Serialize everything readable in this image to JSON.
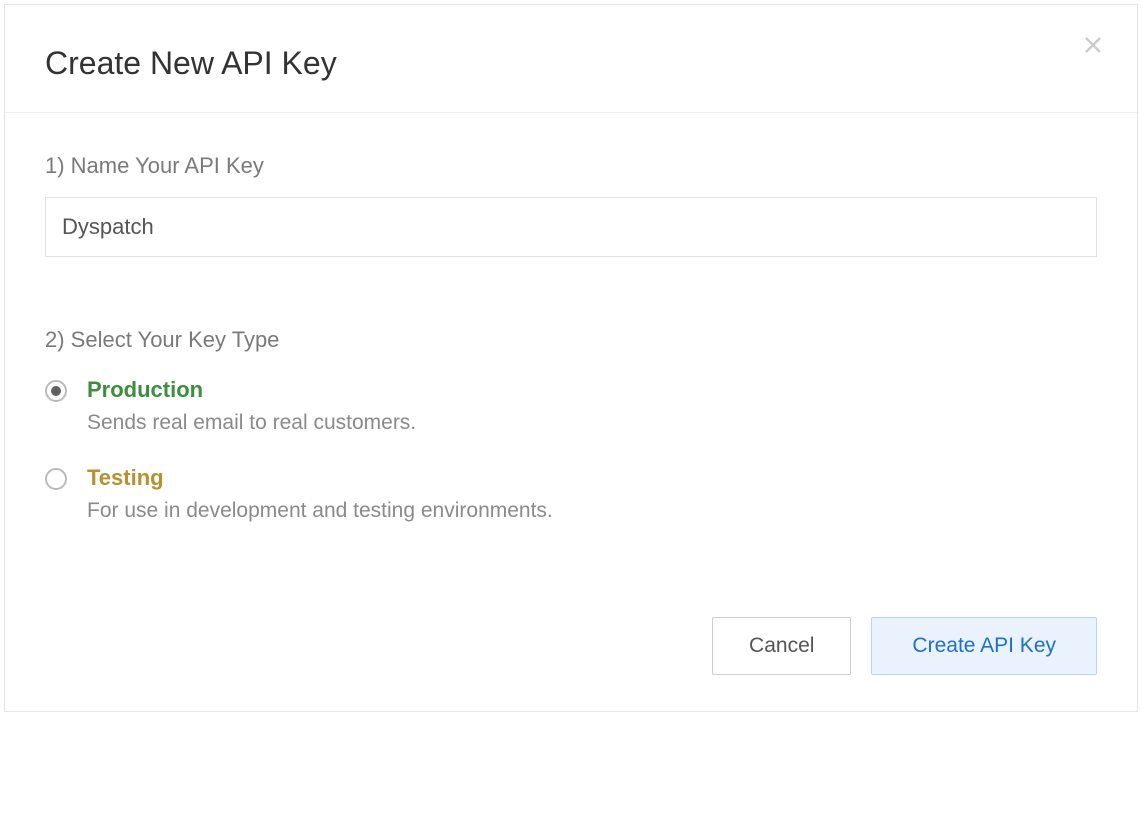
{
  "modal": {
    "title": "Create New API Key",
    "step1": {
      "label": "1) Name Your API Key",
      "value": "Dyspatch"
    },
    "step2": {
      "label": "2) Select Your Key Type",
      "options": [
        {
          "title": "Production",
          "description": "Sends real email to real customers.",
          "selected": true,
          "colorClass": "production"
        },
        {
          "title": "Testing",
          "description": "For use in development and testing environments.",
          "selected": false,
          "colorClass": "testing"
        }
      ]
    },
    "footer": {
      "cancel": "Cancel",
      "submit": "Create API Key"
    }
  }
}
